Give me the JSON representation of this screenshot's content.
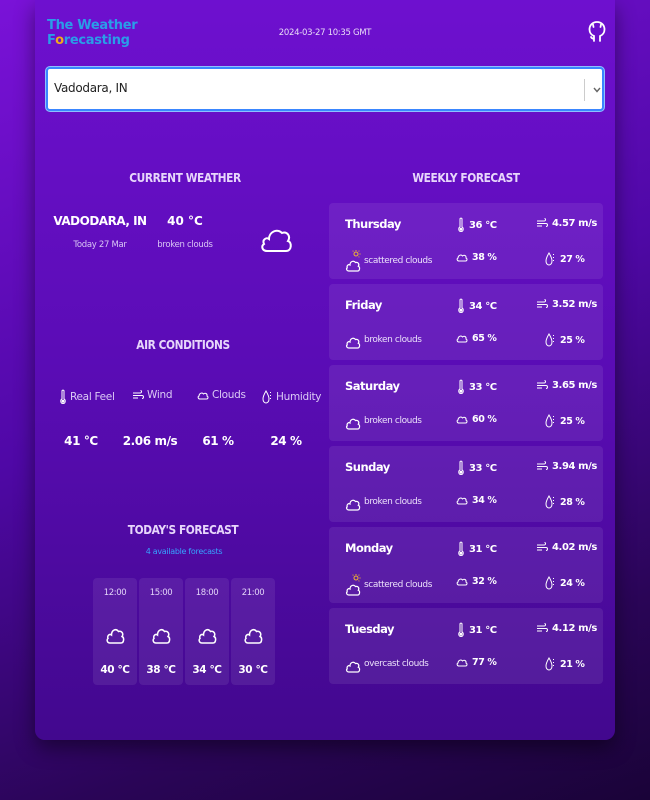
{
  "header": {
    "logo_line1": "The Weather",
    "logo_line2_first": "F",
    "logo_line2_o": "o",
    "logo_line2_rest": "recasting",
    "datetime": "2024-03-27 10:35 GMT",
    "github_icon": "github-icon"
  },
  "search": {
    "value": "Vadodara, IN",
    "dropdown_icon": "chevron-down-icon"
  },
  "current_weather": {
    "title": "CURRENT WEATHER",
    "city": "VADODARA, IN",
    "date": "Today 27 Mar",
    "temp": "40 °C",
    "description": "broken clouds",
    "icon": "cloud-icon"
  },
  "air_conditions": {
    "title": "AIR CONDITIONS",
    "items": [
      {
        "label": "Real Feel",
        "value": "41 °C",
        "icon": "thermometer-icon"
      },
      {
        "label": "Wind",
        "value": "2.06 m/s",
        "icon": "wind-icon"
      },
      {
        "label": "Clouds",
        "value": "61 %",
        "icon": "cloud-icon"
      },
      {
        "label": "Humidity",
        "value": "24 %",
        "icon": "humidity-icon"
      }
    ]
  },
  "todays_forecast": {
    "title": "TODAY'S FORECAST",
    "subtitle": "4 available forecasts",
    "items": [
      {
        "time": "12:00",
        "temp": "40 °C",
        "icon": "cloud-icon"
      },
      {
        "time": "15:00",
        "temp": "38 °C",
        "icon": "cloud-icon"
      },
      {
        "time": "18:00",
        "temp": "34 °C",
        "icon": "cloud-icon"
      },
      {
        "time": "21:00",
        "temp": "30 °C",
        "icon": "cloud-icon"
      }
    ]
  },
  "weekly_forecast": {
    "title": "WEEKLY FORECAST",
    "days": [
      {
        "day": "Thursday",
        "temp": "36 °C",
        "wind": "4.57 m/s",
        "desc": "scattered clouds",
        "clouds": "38 %",
        "humidity": "27 %",
        "icon": "sun-cloud-icon"
      },
      {
        "day": "Friday",
        "temp": "34 °C",
        "wind": "3.52 m/s",
        "desc": "broken clouds",
        "clouds": "65 %",
        "humidity": "25 %",
        "icon": "cloud-icon"
      },
      {
        "day": "Saturday",
        "temp": "33 °C",
        "wind": "3.65 m/s",
        "desc": "broken clouds",
        "clouds": "60 %",
        "humidity": "25 %",
        "icon": "cloud-icon"
      },
      {
        "day": "Sunday",
        "temp": "33 °C",
        "wind": "3.94 m/s",
        "desc": "broken clouds",
        "clouds": "34 %",
        "humidity": "28 %",
        "icon": "cloud-icon"
      },
      {
        "day": "Monday",
        "temp": "31 °C",
        "wind": "4.02 m/s",
        "desc": "scattered clouds",
        "clouds": "32 %",
        "humidity": "24 %",
        "icon": "sun-cloud-icon"
      },
      {
        "day": "Tuesday",
        "temp": "31 °C",
        "wind": "4.12 m/s",
        "desc": "overcast clouds",
        "clouds": "77 %",
        "humidity": "21 %",
        "icon": "cloud-icon"
      }
    ]
  },
  "colors": {
    "background": "#5a0cb5",
    "accent": "#3a86ff",
    "logo_blue": "#2a9de8",
    "logo_orange": "#f2a81d",
    "subtitle_blue": "#36a3ff"
  }
}
